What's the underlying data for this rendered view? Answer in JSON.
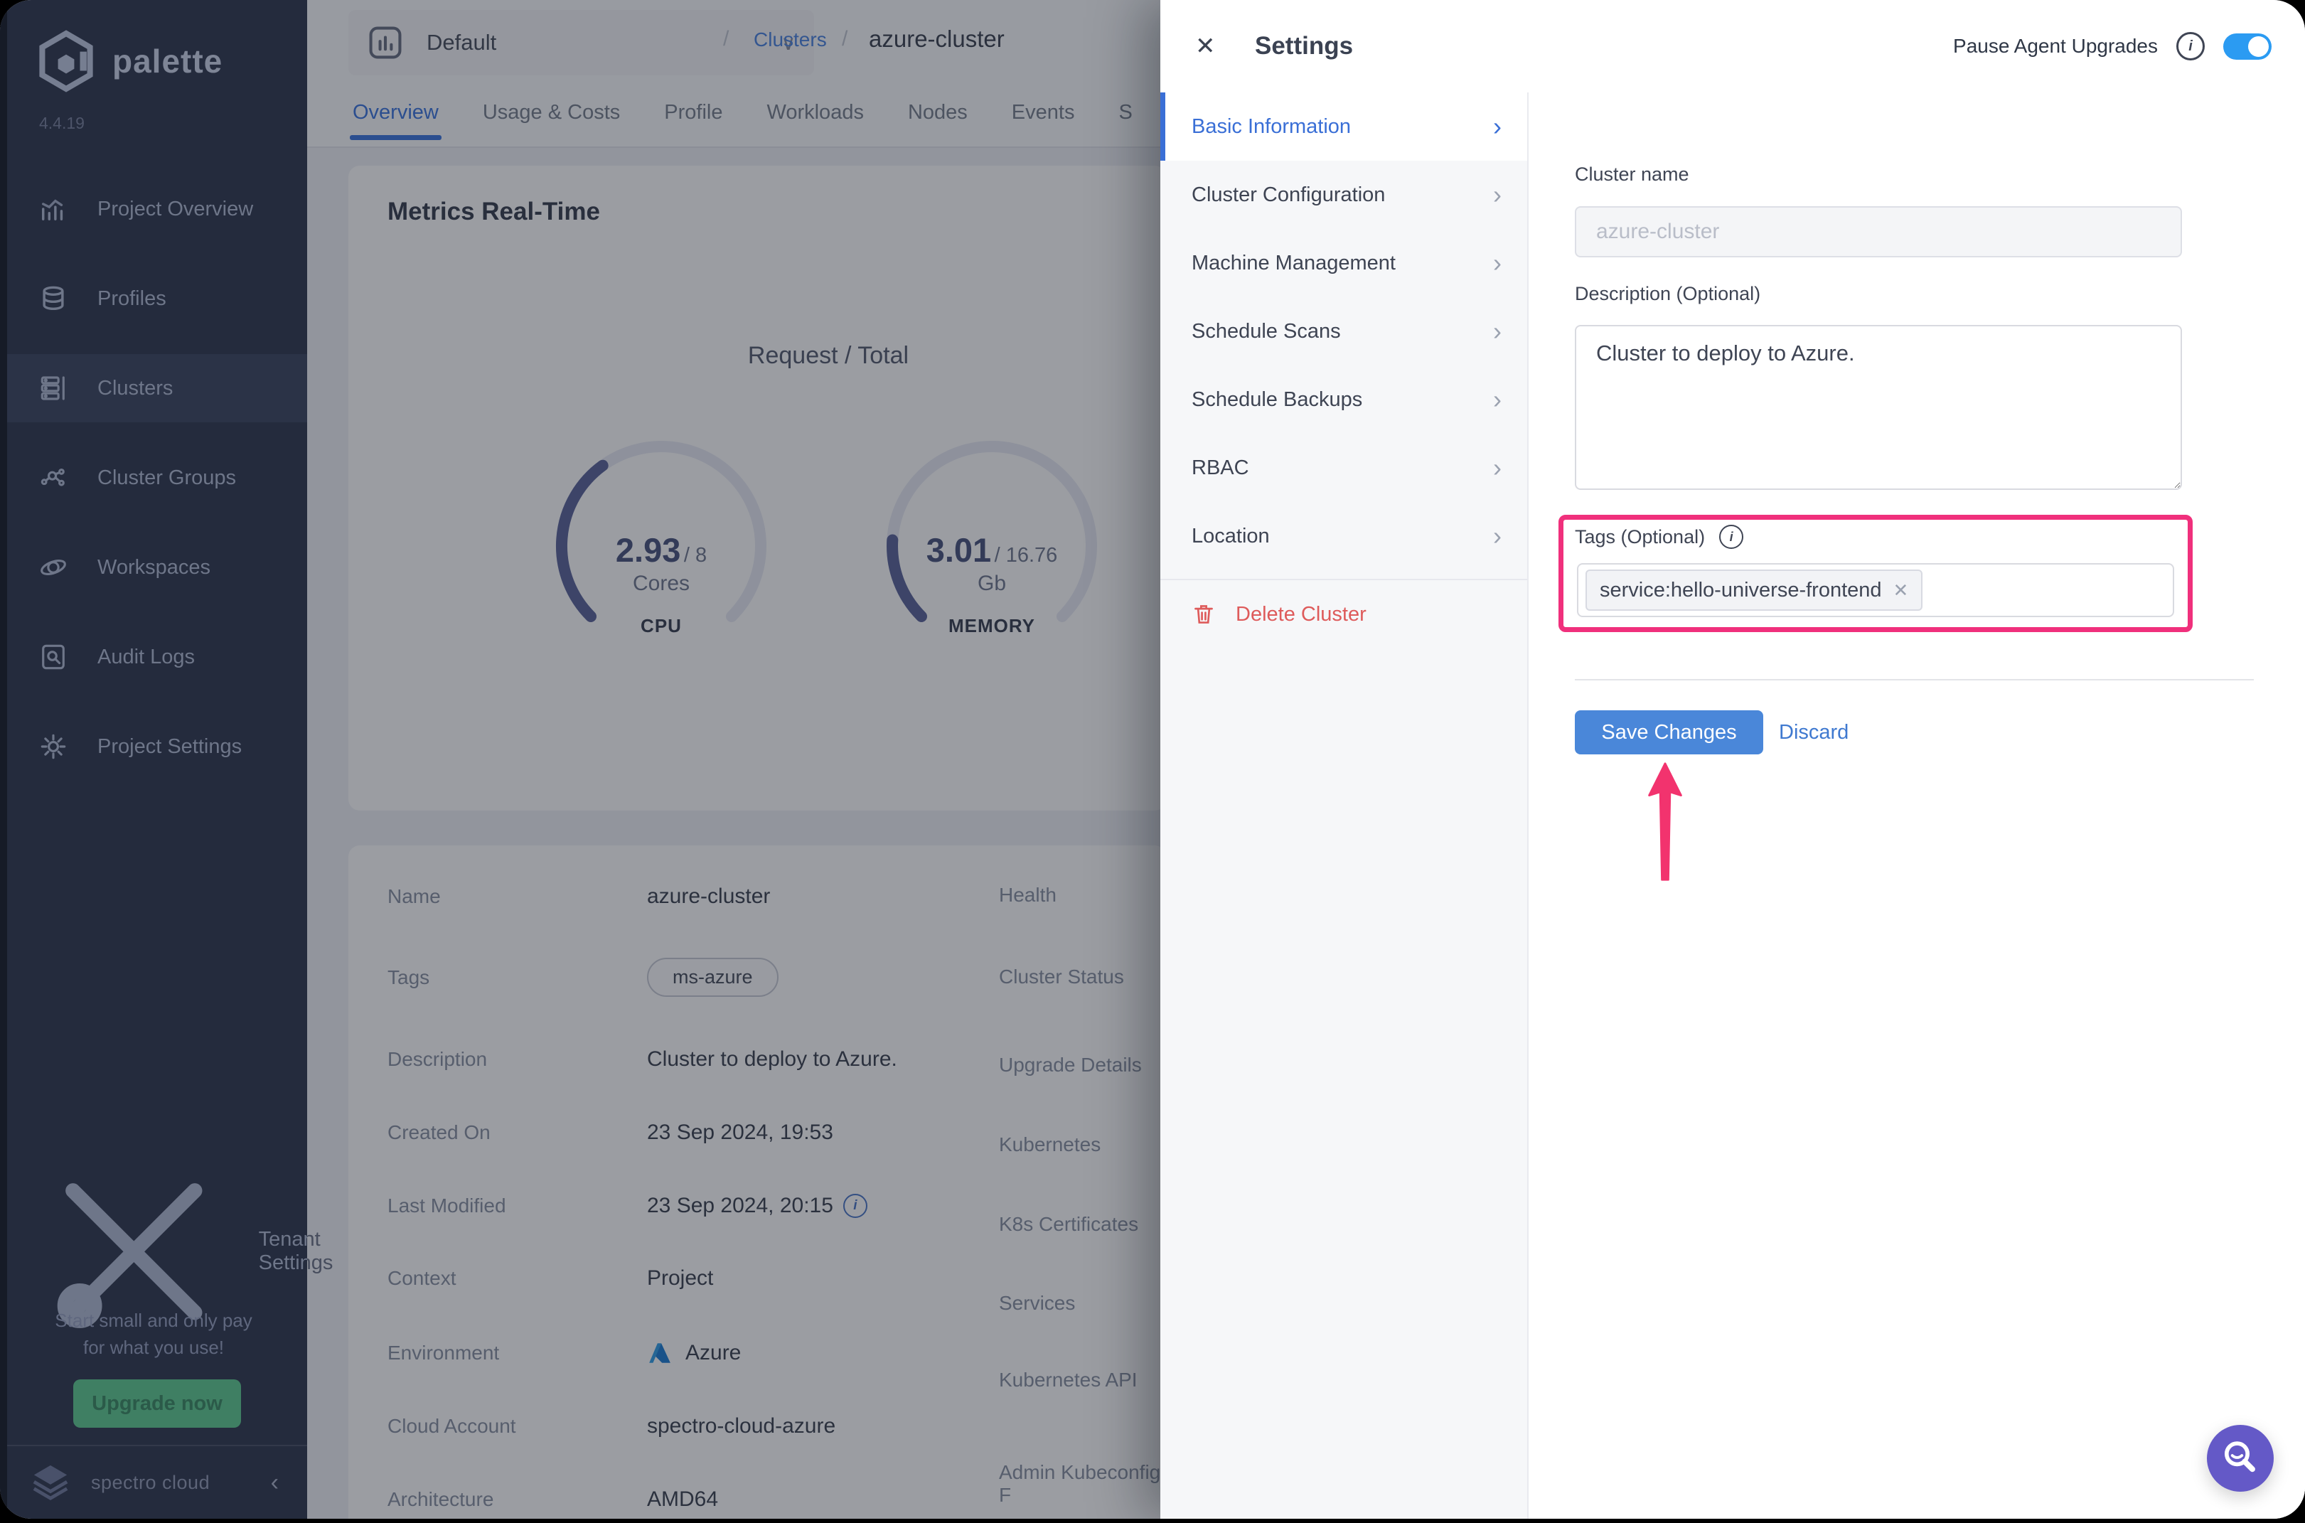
{
  "colors": {
    "sidebar_bg": "#242b3d",
    "accent_blue": "#3a6fd6",
    "link_blue": "#4e86e0",
    "save_blue": "#4a87d9",
    "toggle_blue": "#2b9bf2",
    "delete_red": "#de5b5b",
    "annotation_pink": "#f0307c",
    "fab_purple": "#6459c7",
    "upgrade_green": "#3f7f63"
  },
  "icons": {
    "close": "✕",
    "chevron_right": "›",
    "chevron_down": "∨",
    "chevron_left": "‹",
    "breadcrumb_separator": "/",
    "info": "i",
    "tag_remove": "✕"
  },
  "sidebar": {
    "logo": "palette",
    "version": "4.4.19",
    "items": [
      {
        "label": "Project Overview",
        "active": false
      },
      {
        "label": "Profiles",
        "active": false
      },
      {
        "label": "Clusters",
        "active": true
      },
      {
        "label": "Cluster Groups",
        "active": false
      },
      {
        "label": "Workspaces",
        "active": false
      },
      {
        "label": "Audit Logs",
        "active": false
      },
      {
        "label": "Project Settings",
        "active": false
      }
    ],
    "tenant": "Tenant Settings",
    "promo_line1": "Start small and only pay",
    "promo_line2": "for what you use!",
    "upgrade": "Upgrade now",
    "brand": "spectro cloud"
  },
  "header": {
    "project": "Default",
    "breadcrumb_section": "Clusters",
    "breadcrumb_current": "azure-cluster"
  },
  "tabs": {
    "active": "Overview",
    "items": [
      "Overview",
      "Usage & Costs",
      "Profile",
      "Workloads",
      "Nodes",
      "Events"
    ],
    "partial": "S"
  },
  "metrics": {
    "title": "Metrics Real-Time",
    "subtitle": "Request / Total",
    "cpu": {
      "value": "2.93",
      "total": "/ 8",
      "unit": "Cores",
      "label": "CPU",
      "fraction": 0.366
    },
    "memory": {
      "value": "3.01",
      "total": "/ 16.76",
      "unit": "Gb",
      "label": "MEMORY",
      "fraction": 0.18
    }
  },
  "details": {
    "left": [
      {
        "label": "Name",
        "value": "azure-cluster"
      },
      {
        "label": "Tags",
        "value": "ms-azure"
      },
      {
        "label": "Description",
        "value": "Cluster to deploy to Azure."
      },
      {
        "label": "Created On",
        "value": "23 Sep 2024, 19:53"
      },
      {
        "label": "Last Modified",
        "value": "23 Sep 2024, 20:15"
      },
      {
        "label": "Context",
        "value": "Project"
      },
      {
        "label": "Environment",
        "value": "Azure"
      },
      {
        "label": "Cloud Account",
        "value": "spectro-cloud-azure"
      },
      {
        "label": "Architecture",
        "value": "AMD64"
      }
    ],
    "right": [
      "Health",
      "Cluster Status",
      "Upgrade Details",
      "Kubernetes",
      "K8s Certificates",
      "Services",
      "Kubernetes API",
      "Admin Kubeconfig F"
    ]
  },
  "drawer": {
    "title": "Settings",
    "pause_label": "Pause Agent Upgrades",
    "pause_toggle_on": true,
    "nav": [
      "Basic Information",
      "Cluster Configuration",
      "Machine Management",
      "Schedule Scans",
      "Schedule Backups",
      "RBAC",
      "Location"
    ],
    "active_nav": "Basic Information",
    "delete": "Delete Cluster",
    "form": {
      "name_label": "Cluster name",
      "name_value": "azure-cluster",
      "desc_label": "Description (Optional)",
      "desc_value": "Cluster to deploy to Azure.",
      "tags_label": "Tags (Optional)",
      "tag": "service:hello-universe-frontend",
      "save": "Save Changes",
      "discard": "Discard"
    }
  }
}
